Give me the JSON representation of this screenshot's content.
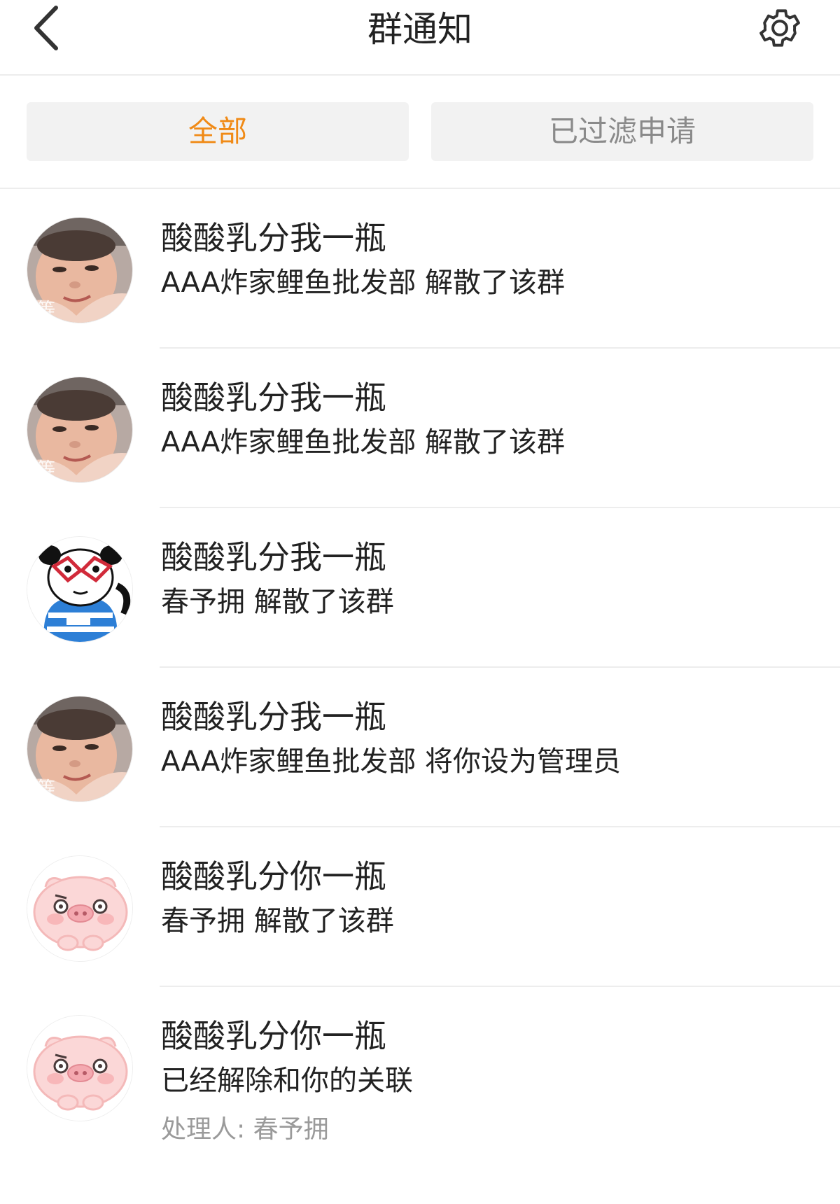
{
  "header": {
    "title": "群通知",
    "back_icon": "chevron-left-icon",
    "settings_icon": "gear-icon"
  },
  "tabs": [
    {
      "label": "全部",
      "active": true
    },
    {
      "label": "已过滤申请",
      "active": false
    }
  ],
  "colors": {
    "accent": "#f08a16",
    "inactive_tab_text": "#8a8a8a",
    "tab_background": "#f2f2f2",
    "handler_text": "#9a9a9a"
  },
  "notifications": [
    {
      "avatar": "boy-photo-avatar",
      "name": "酸酸乳分我一瓶",
      "message": "AAA炸家鲤鱼批发部 解散了该群"
    },
    {
      "avatar": "boy-photo-avatar",
      "name": "酸酸乳分我一瓶",
      "message": "AAA炸家鲤鱼批发部 解散了该群"
    },
    {
      "avatar": "panda-meme-avatar",
      "name": "酸酸乳分我一瓶",
      "message": "春予拥 解散了该群"
    },
    {
      "avatar": "boy-photo-avatar",
      "name": "酸酸乳分我一瓶",
      "message": "AAA炸家鲤鱼批发部 将你设为管理员"
    },
    {
      "avatar": "pink-pig-avatar",
      "name": "酸酸乳分你一瓶",
      "message": "春予拥 解散了该群"
    },
    {
      "avatar": "pink-pig-avatar",
      "name": "酸酸乳分你一瓶",
      "message": "已经解除和你的关联",
      "handler": "处理人: 春予拥"
    }
  ],
  "avatar_overlay_text": "等"
}
